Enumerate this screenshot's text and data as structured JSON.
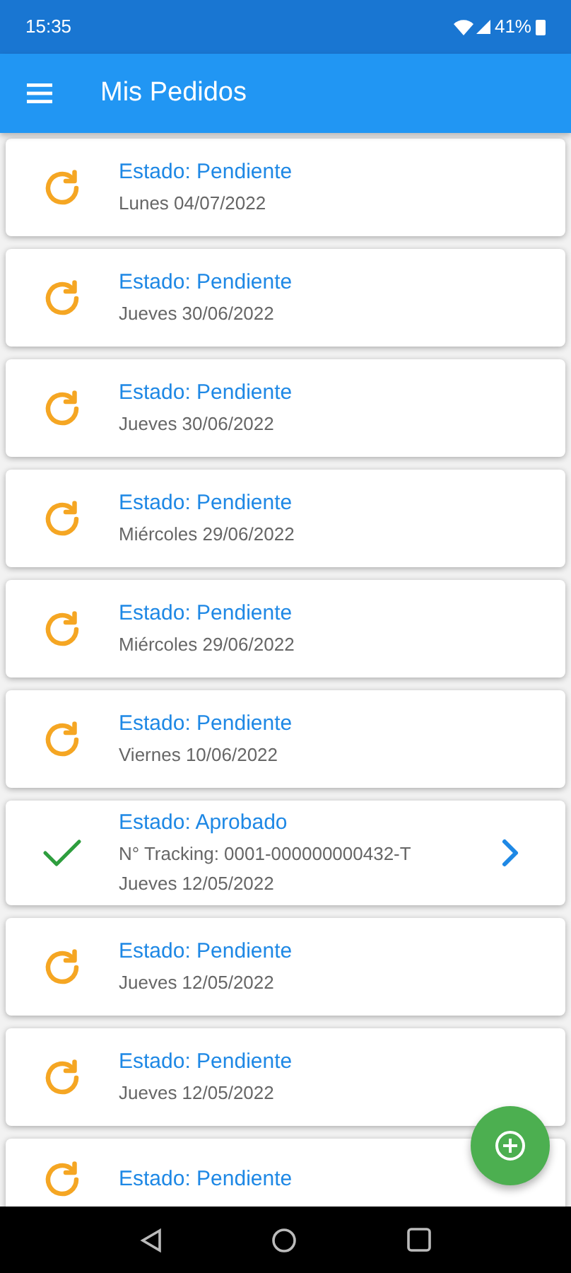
{
  "status_bar": {
    "time": "15:35",
    "battery": "41%"
  },
  "app_bar": {
    "title": "Mis Pedidos"
  },
  "orders": [
    {
      "kind": "pending",
      "status": "Estado: Pendiente",
      "date": "Lunes 04/07/2022"
    },
    {
      "kind": "pending",
      "status": "Estado: Pendiente",
      "date": "Jueves 30/06/2022"
    },
    {
      "kind": "pending",
      "status": "Estado: Pendiente",
      "date": "Jueves 30/06/2022"
    },
    {
      "kind": "pending",
      "status": "Estado: Pendiente",
      "date": "Miércoles 29/06/2022"
    },
    {
      "kind": "pending",
      "status": "Estado: Pendiente",
      "date": "Miércoles 29/06/2022"
    },
    {
      "kind": "pending",
      "status": "Estado: Pendiente",
      "date": "Viernes 10/06/2022"
    },
    {
      "kind": "approved",
      "status": "Estado: Aprobado",
      "tracking": "N° Tracking: 0001-000000000432-T",
      "date": "Jueves 12/05/2022"
    },
    {
      "kind": "pending",
      "status": "Estado: Pendiente",
      "date": "Jueves 12/05/2022"
    },
    {
      "kind": "pending",
      "status": "Estado: Pendiente",
      "date": "Jueves 12/05/2022"
    },
    {
      "kind": "pending",
      "status": "Estado: Pendiente"
    }
  ]
}
